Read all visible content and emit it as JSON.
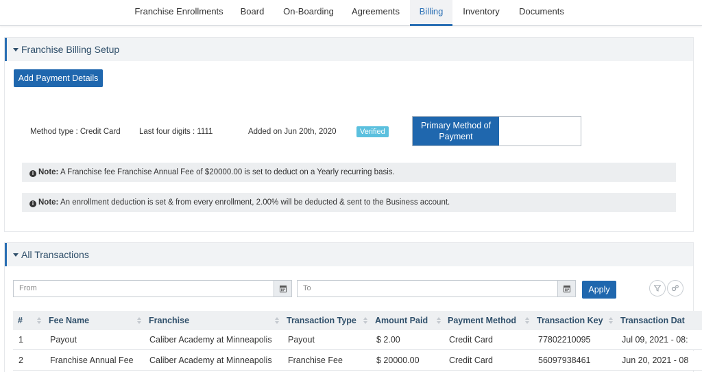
{
  "nav": {
    "tabs": [
      {
        "label": "Franchise Enrollments"
      },
      {
        "label": "Board"
      },
      {
        "label": "On-Boarding"
      },
      {
        "label": "Agreements"
      },
      {
        "label": "Billing"
      },
      {
        "label": "Inventory"
      },
      {
        "label": "Documents"
      }
    ],
    "active": "Billing"
  },
  "billing_setup": {
    "title": "Franchise Billing Setup",
    "add_button": "Add Payment Details",
    "method": {
      "type": "Method type : Credit Card",
      "last_four": "Last four digits : 1111",
      "added": "Added on Jun 20th, 2020",
      "status": "Verified",
      "primary_line1": "Primary Method of",
      "primary_line2": "Payment"
    },
    "notes": [
      {
        "label": "Note:",
        "text": "A Franchise fee Franchise Annual Fee of $20000.00 is set to deduct on a Yearly recurring basis."
      },
      {
        "label": "Note:",
        "text": "An enrollment deduction is set & from every enrollment, 2.00% will be deducted & sent to the Business account."
      }
    ]
  },
  "transactions": {
    "title": "All Transactions",
    "from_placeholder": "From",
    "to_placeholder": "To",
    "apply_label": "Apply",
    "columns": [
      "#",
      "Fee Name",
      "Franchise",
      "Transaction Type",
      "Amount Paid",
      "Payment Method",
      "Transaction Key",
      "Transaction Dat"
    ],
    "rows": [
      [
        "1",
        "Payout",
        "Caliber Academy at Minneapolis",
        "Payout",
        "$ 2.00",
        "Credit Card",
        "77802210095",
        "Jul 09, 2021 - 08:"
      ],
      [
        "2",
        "Franchise Annual Fee",
        "Caliber Academy at Minneapolis",
        "Franchise Fee",
        "$ 20000.00",
        "Credit Card",
        "56097938461",
        "Jun 20, 2021 - 08"
      ]
    ]
  },
  "colors": {
    "primary": "#1f67ae",
    "verified": "#5bc0de",
    "heading": "#2f4f6a"
  }
}
